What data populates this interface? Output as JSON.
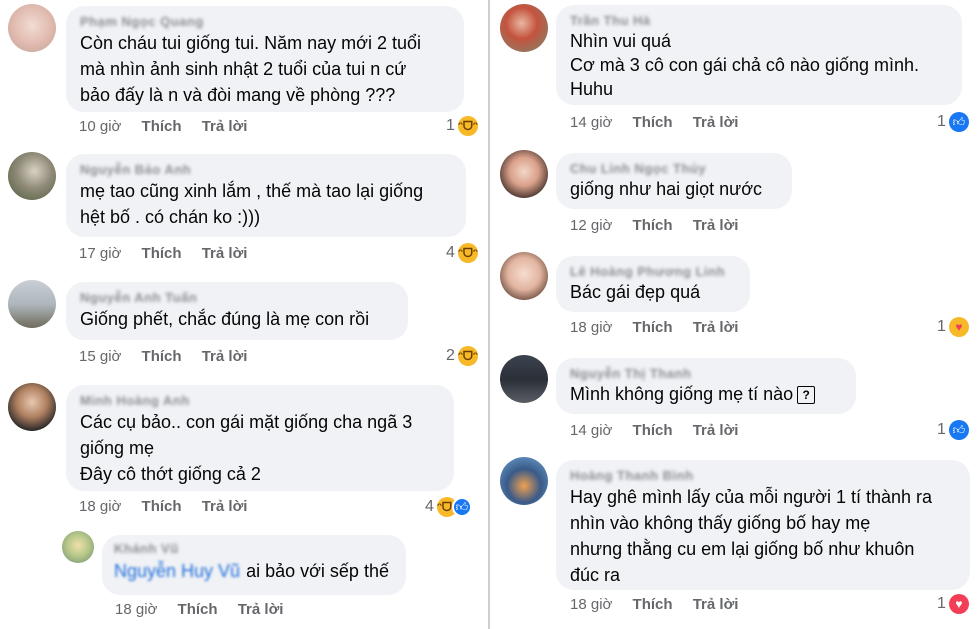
{
  "comments": [
    {
      "name": "Phạm Ngọc Quang",
      "text": "Còn cháu tui giống tui. Năm nay mới 2 tuổi\nmà nhìn ảnh sinh nhật 2 tuổi của tui n cứ\nbảo đấy là n và đòi mang về phòng ???",
      "time": "10 giờ",
      "like": "Thích",
      "reply": "Trả lời",
      "reactions": "1",
      "icons": [
        "haha-icon"
      ]
    },
    {
      "name": "Nguyễn Bảo Anh",
      "text": "mẹ tao cũng xinh lắm , thế mà tao lại giống\nhệt bố . có chán ko :)))",
      "time": "17 giờ",
      "like": "Thích",
      "reply": "Trả lời",
      "reactions": "4",
      "icons": [
        "haha-icon"
      ]
    },
    {
      "name": "Nguyễn Anh Tuấn",
      "text": "Giống phết, chắc đúng là mẹ con rồi",
      "time": "15 giờ",
      "like": "Thích",
      "reply": "Trả lời",
      "reactions": "2",
      "icons": [
        "haha-icon"
      ]
    },
    {
      "name": "Minh Hoàng Anh",
      "text": "Các cụ bảo.. con gái mặt giống cha ngã 3\ngiống mẹ\nĐây cô thớt giống cả 2",
      "time": "18 giờ",
      "like": "Thích",
      "reply": "Trả lời",
      "reactions": "4",
      "icons": [
        "haha-icon",
        "like-icon"
      ]
    },
    {
      "name": "Khánh Vũ",
      "mention": "Nguyễn Huy Vũ",
      "text": "ai bảo với sếp thế",
      "time": "18 giờ",
      "like": "Thích",
      "reply": "Trả lời"
    },
    {
      "name": "Trần Thu Hà",
      "text": "Nhìn vui quá\nCơ mà 3 cô con gái chả cô nào giống mình.\nHuhu",
      "time": "14 giờ",
      "like": "Thích",
      "reply": "Trả lời",
      "reactions": "1",
      "icons": [
        "like-icon"
      ]
    },
    {
      "name": "Chu Linh Ngọc Thủy",
      "text": "giống như hai giọt nước",
      "time": "12 giờ",
      "like": "Thích",
      "reply": "Trả lời"
    },
    {
      "name": "Lê Hoàng Phương Linh",
      "text": "Bác gái đẹp quá",
      "time": "18 giờ",
      "like": "Thích",
      "reply": "Trả lời",
      "reactions": "1",
      "icons": [
        "care-icon"
      ]
    },
    {
      "name": "Nguyễn Thị Thanh",
      "text": "Mình không giống mẹ tí nào",
      "time": "14 giờ",
      "like": "Thích",
      "reply": "Trả lời",
      "reactions": "1",
      "icons": [
        "like-icon"
      ]
    },
    {
      "name": "Hoàng Thanh Bình",
      "text": "Hay ghê mình lấy của mỗi người 1 tí thành ra\nnhìn vào không thấy giống bố hay mẹ\nnhưng thằng cu em lại giống bố như khuôn\nđúc ra",
      "time": "18 giờ",
      "like": "Thích",
      "reply": "Trả lời",
      "reactions": "1",
      "icons": [
        "love-icon"
      ]
    }
  ],
  "colors": {
    "bubble": "#f0f2f5",
    "meta": "#65676b",
    "like": "#1877f2",
    "haha": "#f7b928",
    "love": "#f33e58"
  }
}
